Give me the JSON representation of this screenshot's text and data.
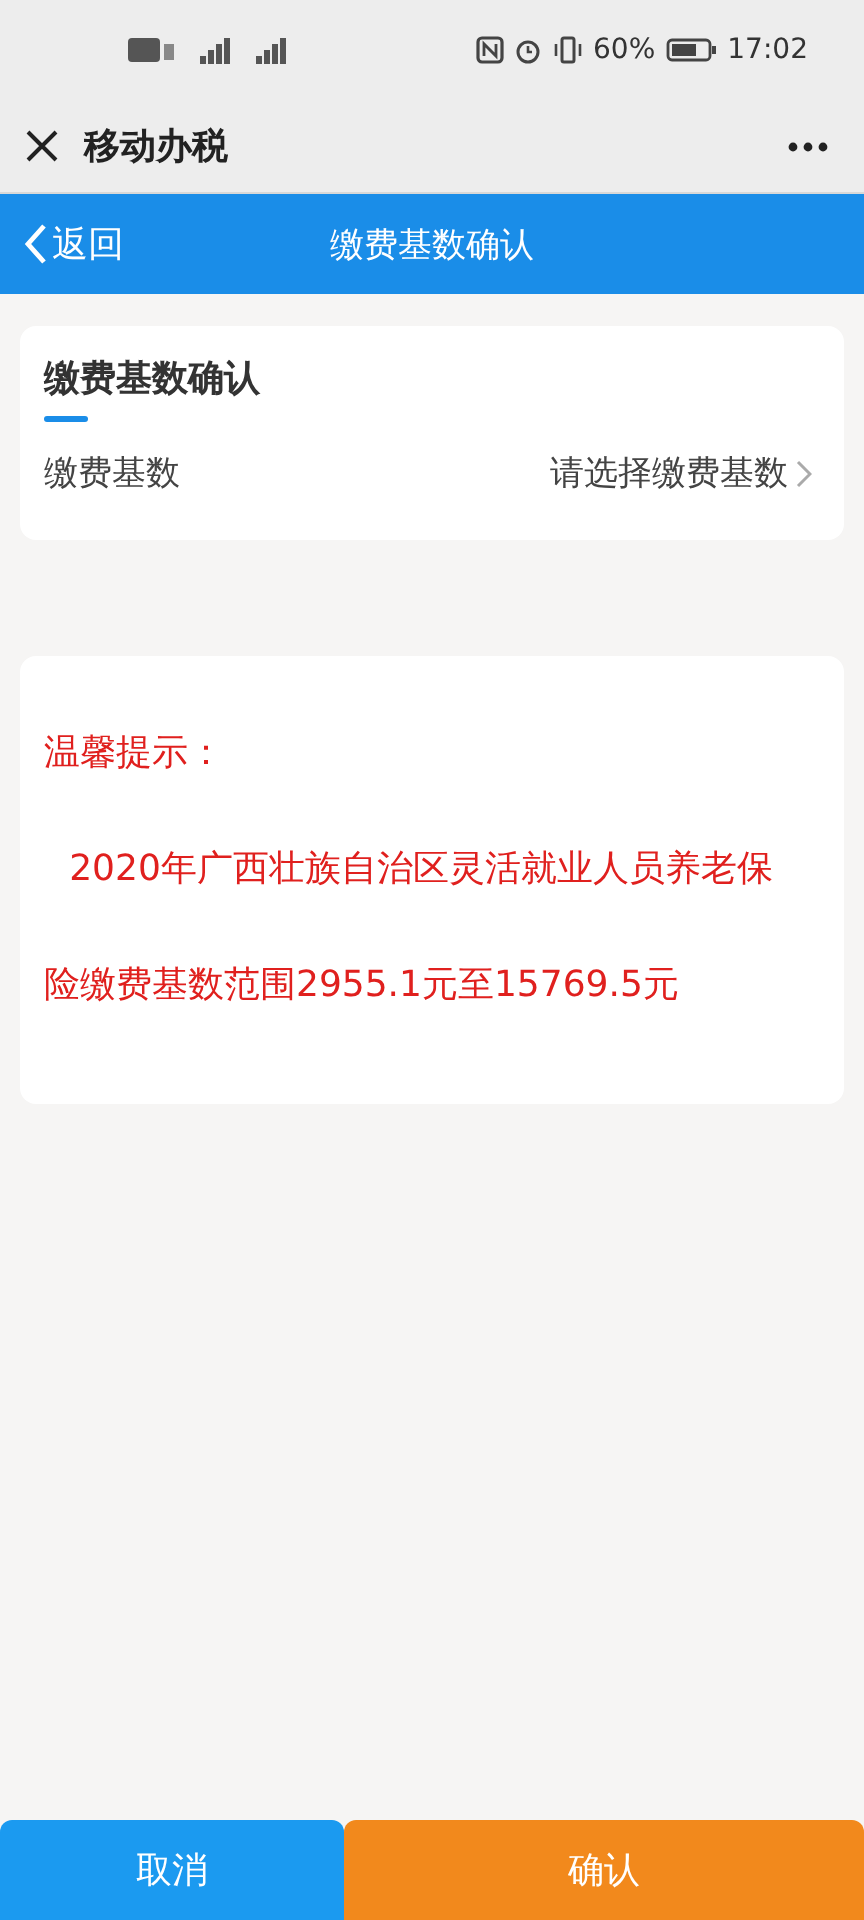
{
  "status_bar": {
    "battery": "60%",
    "time": "17:02"
  },
  "app_bar": {
    "title": "移动办税"
  },
  "nav_bar": {
    "back": "返回",
    "title": "缴费基数确认"
  },
  "form_card": {
    "title": "缴费基数确认",
    "fields": [
      {
        "label": "缴费基数",
        "placeholder": "请选择缴费基数"
      }
    ]
  },
  "notice": {
    "heading": "温馨提示：",
    "body": "2020年广西壮族自治区灵活就业人员养老保险缴费基数范围2955.1元至15769.5元"
  },
  "buttons": [
    {
      "label": "取消",
      "kind": "cancel"
    },
    {
      "label": "确认",
      "kind": "confirm"
    }
  ]
}
